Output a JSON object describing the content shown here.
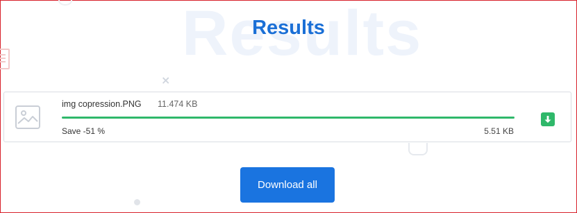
{
  "page": {
    "title": "Results",
    "watermark": "Results"
  },
  "result": {
    "file_name": "img copression.PNG",
    "original_size": "11.474 KB",
    "save_label": "Save -51 %",
    "new_size": "5.51 KB",
    "progress_fraction": 1.0,
    "thumbnail_icon": "image-placeholder-icon",
    "download_icon": "download-arrow-icon"
  },
  "actions": {
    "download_all_label": "Download all"
  },
  "colors": {
    "accent_blue": "#1a6fd6",
    "button_blue": "#1a74e0",
    "success_green": "#2fb86a",
    "frame_red": "#d8202a"
  }
}
